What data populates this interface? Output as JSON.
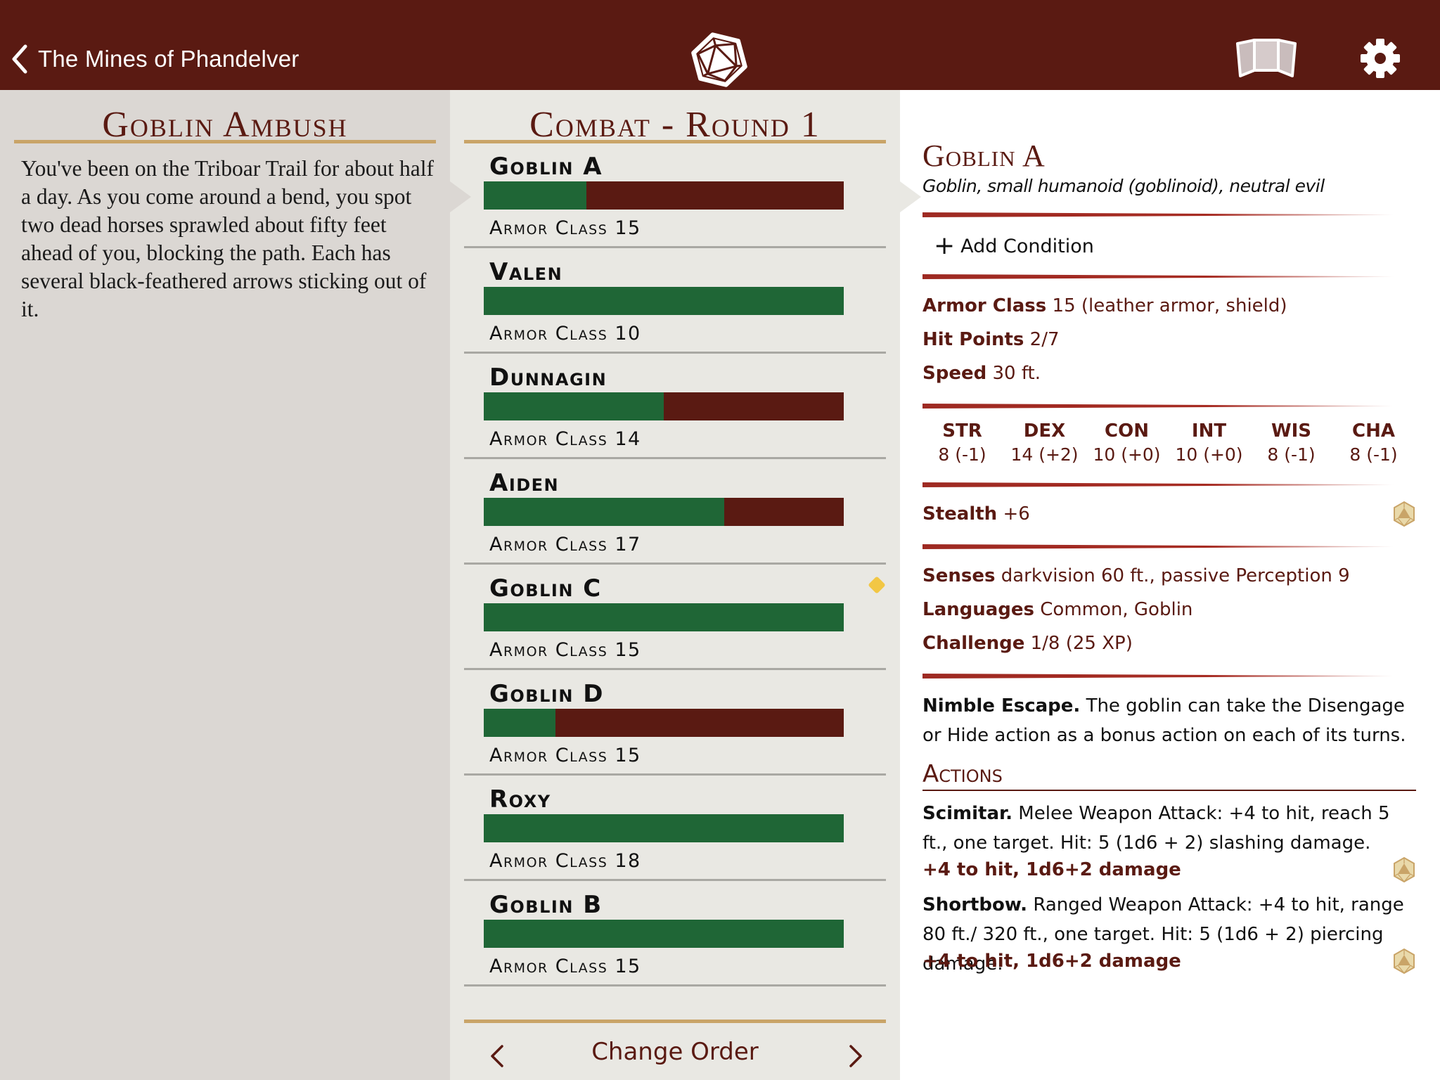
{
  "header": {
    "back_label": "The Mines of Phandelver",
    "icons": [
      "chevron-left-icon",
      "d20-icon",
      "dm-screen-icon",
      "gear-icon"
    ]
  },
  "encounter": {
    "title": "Goblin Ambush",
    "description": "You've been on the Triboar Trail for about half a day. As you come around a bend, you spot two dead horses sprawled about fifty feet ahead of you, blocking the path. Each has several black-feathered arrows sticking out of it."
  },
  "combat": {
    "title": "Combat - Round 1",
    "colors": {
      "hp_remaining": "#1f6636",
      "hp_lost": "#5a1a12",
      "turn_marker": "#f2c744"
    },
    "combatants": [
      {
        "name": "Goblin A",
        "armor_class": "Armor Class 15",
        "hp_fraction": 0.2857,
        "selected": true,
        "marker": false
      },
      {
        "name": "Valen",
        "armor_class": "Armor Class 10",
        "hp_fraction": 1.0,
        "selected": false,
        "marker": false
      },
      {
        "name": "Dunnagin",
        "armor_class": "Armor Class 14",
        "hp_fraction": 0.5,
        "selected": false,
        "marker": false
      },
      {
        "name": "Aiden",
        "armor_class": "Armor Class 17",
        "hp_fraction": 0.667,
        "selected": false,
        "marker": false
      },
      {
        "name": "Goblin C",
        "armor_class": "Armor Class 15",
        "hp_fraction": 1.0,
        "selected": false,
        "marker": true
      },
      {
        "name": "Goblin D",
        "armor_class": "Armor Class 15",
        "hp_fraction": 0.2,
        "selected": false,
        "marker": false
      },
      {
        "name": "Roxy",
        "armor_class": "Armor Class 18",
        "hp_fraction": 1.0,
        "selected": false,
        "marker": false
      },
      {
        "name": "Goblin B",
        "armor_class": "Armor Class 15",
        "hp_fraction": 1.0,
        "selected": false,
        "marker": false
      }
    ],
    "change_order_label": "Change Order"
  },
  "monster": {
    "name": "Goblin A",
    "type_line": "Goblin, small humanoid (goblinoid), neutral evil",
    "add_condition_label": "Add Condition",
    "armor_class": {
      "label": "Armor Class",
      "value": "15 (leather armor, shield)"
    },
    "hit_points": {
      "label": "Hit Points",
      "value": "2/7"
    },
    "speed": {
      "label": "Speed",
      "value": "30 ft."
    },
    "abilities": [
      {
        "key": "STR",
        "value": "8 (-1)"
      },
      {
        "key": "DEX",
        "value": "14 (+2)"
      },
      {
        "key": "CON",
        "value": "10 (+0)"
      },
      {
        "key": "INT",
        "value": "10 (+0)"
      },
      {
        "key": "WIS",
        "value": "8 (-1)"
      },
      {
        "key": "CHA",
        "value": "8 (-1)"
      }
    ],
    "skills": {
      "label": "Stealth",
      "value": "+6"
    },
    "senses": {
      "label": "Senses",
      "value": "darkvision 60 ft., passive Perception 9"
    },
    "languages": {
      "label": "Languages",
      "value": "Common, Goblin"
    },
    "challenge": {
      "label": "Challenge",
      "value": "1/8 (25 XP)"
    },
    "traits": [
      {
        "name": "Nimble Escape.",
        "text": "The goblin can take the Disengage or Hide action as a bonus action on each of its turns."
      }
    ],
    "actions_heading": "Actions",
    "actions": [
      {
        "name": "Scimitar.",
        "text": "Melee Weapon Attack: +4 to hit, reach 5 ft., one target. Hit: 5 (1d6 + 2) slashing damage.",
        "roll": "+4 to hit, 1d6+2 damage"
      },
      {
        "name": "Shortbow.",
        "text": "Ranged Weapon Attack: +4 to hit, range 80 ft./ 320 ft., one target. Hit: 5 (1d6 + 2) piercing damage.",
        "roll": "+4 to hit, 1d6+2 damage"
      }
    ]
  }
}
